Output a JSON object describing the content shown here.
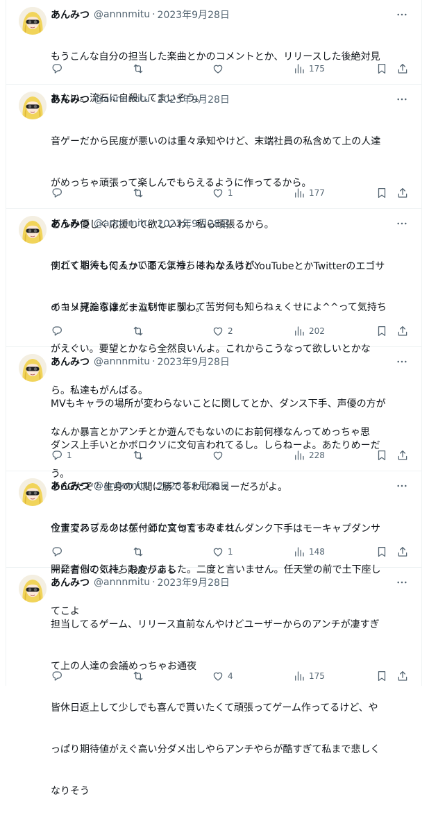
{
  "user": {
    "name": "あんみつ",
    "handle": "@annnmitu",
    "separator": "·",
    "avatar_icon": "avatar-icon"
  },
  "colors": {
    "text": "#0f1419",
    "muted": "#536471",
    "border": "#eff3f4"
  },
  "tweets": [
    {
      "date": "2023年9月28日",
      "lines": [
        "もうこんな自分の担当した楽曲とかのコメントとか、リリースした後絶対見",
        "れない。流石に自殺してまいそう。"
      ],
      "replies": "",
      "retweets": "",
      "likes": "",
      "views": "175"
    },
    {
      "date": "2023年9月28日",
      "lines": [
        "音ゲーだから民度が悪いのは重々承知やけど、末端社員の私含めて上の人達",
        "がめっちゃ頑張って楽しんでもらえるように作ってるから。",
        "どうか優しく応援して欲しいわ。私ら頑張るから。",
        "倒れてる人も何人かいるんよな。そんな人らがYouTubeとかTwitterのエゴサ",
        "のコメ見たらほんま泣いてまうわ。"
      ],
      "replies": "",
      "retweets": "",
      "likes": "1",
      "views": "177"
    },
    {
      "date": "2023年9月28日",
      "lines": [
        "すごく期待してるって面で気持ちはわかるけど、",
        "イキリ評論家達ゲーム制作に関して苦労何も知らねぇくせによ^^って気持ち",
        "がえぐい。要望とかなら全然良いんよ。これからこうなって欲しいとかな",
        "ら。私達もがんばる。",
        "なんか暴言とかアンチとか遊んでもないのにお前何様なんってめっちゃ思",
        "う。"
      ],
      "replies": "",
      "retweets": "",
      "likes": "2",
      "views": "202"
    },
    {
      "date": "2023年9月28日",
      "lines": [
        "MVもキャラの場所が変わらないことに関してとか、ダンス下手、声優の方が",
        "ダンス上手いとかボロクソに文句言われてるし。しらねーよ。あたりめーだ",
        "ろCGだぞ？生身の人間に勝てるわけねぇーだろがよ。",
        "位置変わらんのは振付師に文句言ってくれ、ダンク下手はモーキャプダンサ",
        "ーに言ってくれ。限度がある"
      ],
      "replies": "1",
      "retweets": "",
      "likes": "",
      "views": "228"
    },
    {
      "date": "2023年9月28日",
      "lines": [
        "今までスプラクソゲーとか言ってすみません",
        "開発者側の気持ちわかりました。二度と言いません。任天堂の前で土下座し",
        "てこよ"
      ],
      "replies": "",
      "retweets": "",
      "likes": "1",
      "views": "148"
    },
    {
      "date": "2023年9月28日",
      "lines": [
        "担当してるゲーム、リリース直前なんやけどユーザーからのアンチが凄すぎ",
        "て上の人達の会議めっちゃお通夜",
        "皆休日返上して少しでも喜んで貰いたくて頑張ってゲーム作ってるけど、や",
        "っぱり期待値がえぐ高い分ダメ出しやらアンチやらが酷すぎて私まで悲しく",
        "なりそう"
      ],
      "replies": "",
      "retweets": "",
      "likes": "4",
      "views": "175"
    }
  ]
}
